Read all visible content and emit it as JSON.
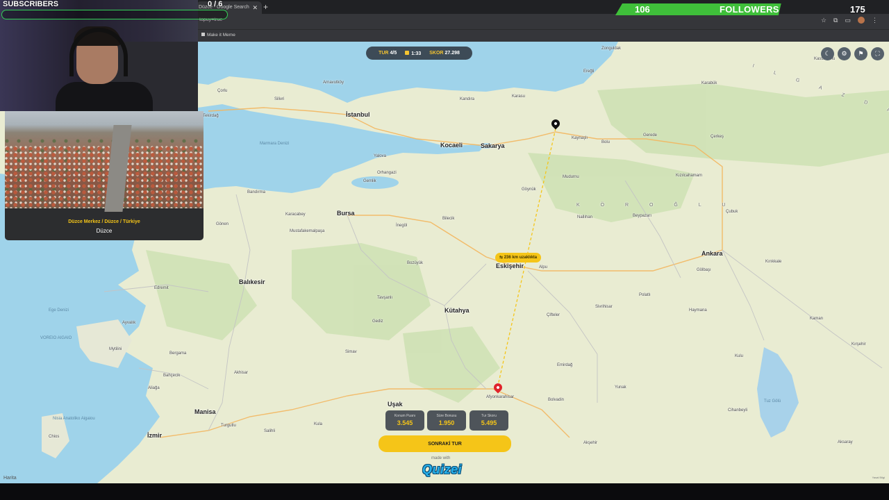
{
  "browser": {
    "tab_title": "Düzce - Google Search",
    "tab_close": "✕",
    "new_tab": "+",
    "url_fragment": "topuy=true",
    "bookmark": "Make it Meme"
  },
  "stream": {
    "subscribers_label": "SUBSCRIBERS",
    "subscribers_count": "0 / 6",
    "subscribers_progress": 0,
    "followers_current": "106",
    "followers_label": "FOLLOWERS",
    "followers_goal": "175",
    "followers_progress": 0.606
  },
  "game": {
    "hud": {
      "round_label": "TUR",
      "round_value": "4/5",
      "time_value": "1:33",
      "score_label": "SKOR",
      "score_value": "27.298"
    },
    "distance_badge": "⇆ 236 km uzaklıkta",
    "scores": [
      {
        "label": "Konum Puanı",
        "value": "3.545"
      },
      {
        "label": "Süre Bonusu",
        "value": "1.950"
      },
      {
        "label": "Tur Skoru",
        "value": "5.495"
      }
    ],
    "next_button": "SONRAKİ TUR",
    "made_with": "made with",
    "logo": "Quizei",
    "location_path": "Düzce Merkez / Düzce / Türkiye",
    "location_name": "Düzce",
    "map_attribution": "Harita",
    "legal": "Yasal Bilgi"
  },
  "map_controls": [
    {
      "name": "dark-mode-icon",
      "glyph": "☾"
    },
    {
      "name": "settings-icon",
      "glyph": "⚙"
    },
    {
      "name": "flag-icon",
      "glyph": "⚑"
    },
    {
      "name": "fullscreen-icon",
      "glyph": "⛶"
    }
  ],
  "places": {
    "istanbul": "İstanbul",
    "kocaeli": "Kocaeli",
    "sakarya": "Sakarya",
    "bursa": "Bursa",
    "eskisehir": "Eskişehir",
    "ankara": "Ankara",
    "izmir": "İzmir",
    "balikesir": "Balıkesir",
    "kutahya": "Kütahya",
    "manisa": "Manisa",
    "usak": "Uşak",
    "zonguldak": "Zonguldak",
    "kastamonu": "Kastamonu",
    "bolu": "Bolu",
    "corlu": "Çorlu",
    "tekirdag": "Tekirdağ",
    "silivri": "Silivri",
    "arnavutkoy": "Arnavutköy",
    "kandira": "Kandıra",
    "karasu": "Karasu",
    "eregli": "Ereğli",
    "yalova": "Yalova",
    "gemlik": "Gemlik",
    "orhangazi": "Orhangazi",
    "inegol": "İnegöl",
    "bozuyuk": "Bozüyük",
    "bilecik": "Bilecik",
    "bandirma": "Bandırma",
    "karacabey": "Karacabey",
    "mustafakemalpasa": "Mustafakemalpaşa",
    "gonen": "Gönen",
    "edremit": "Edremit",
    "ayvalik": "Ayvalık",
    "akhisar": "Akhisar",
    "salihli": "Salihli",
    "turgutlu": "Turgutlu",
    "mytilini": "Mytilini",
    "aliaga": "Aliağa",
    "bergama": "Bergama",
    "bahcecik": "Bahçecik",
    "kula": "Kula",
    "simav": "Simav",
    "tavsanli": "Tavşanlı",
    "gediz": "Gediz",
    "alpu": "Alpu",
    "sivrihisar": "Sivrihisar",
    "cifteler": "Çifteler",
    "emirdag": "Emirdağ",
    "bolvadin": "Bolvadin",
    "afyonkarahisar": "Afyonkarahisar",
    "aksehir": "Akşehir",
    "polatli": "Polatlı",
    "golbasi": "Gölbaşı",
    "kirikkale": "Kırıkkale",
    "cubuk": "Çubuk",
    "cerkes": "Çerkeş",
    "gerede": "Gerede",
    "kizilcahamam": "Kızılcahamam",
    "beypazari": "Beypazarı",
    "nallihan": "Nallıhan",
    "mudurnu": "Mudurnu",
    "goynuk": "Göynük",
    "karabuk": "Karabük",
    "kaman": "Kaman",
    "kirsehir": "Kırşehir",
    "kulu": "Kulu",
    "yunak": "Yunak",
    "cihanbeyli": "Cihanbeyli",
    "aksaray": "Aksaray",
    "heymana": "Haymana",
    "ege": "Ege Denizi",
    "marmara": "Marmara Denizi",
    "voreio": "VOREIO AIGAIO",
    "notio": "Nisia Anatoliko Aigaiou",
    "chios": "Chios",
    "tuz": "Tuz Gölü",
    "koroglu": "K Ö R O Ğ L U",
    "ilgaz": "I L G A Z  D A Ğ L A R I",
    "duzce_lbl": "Kaynaşlı"
  }
}
